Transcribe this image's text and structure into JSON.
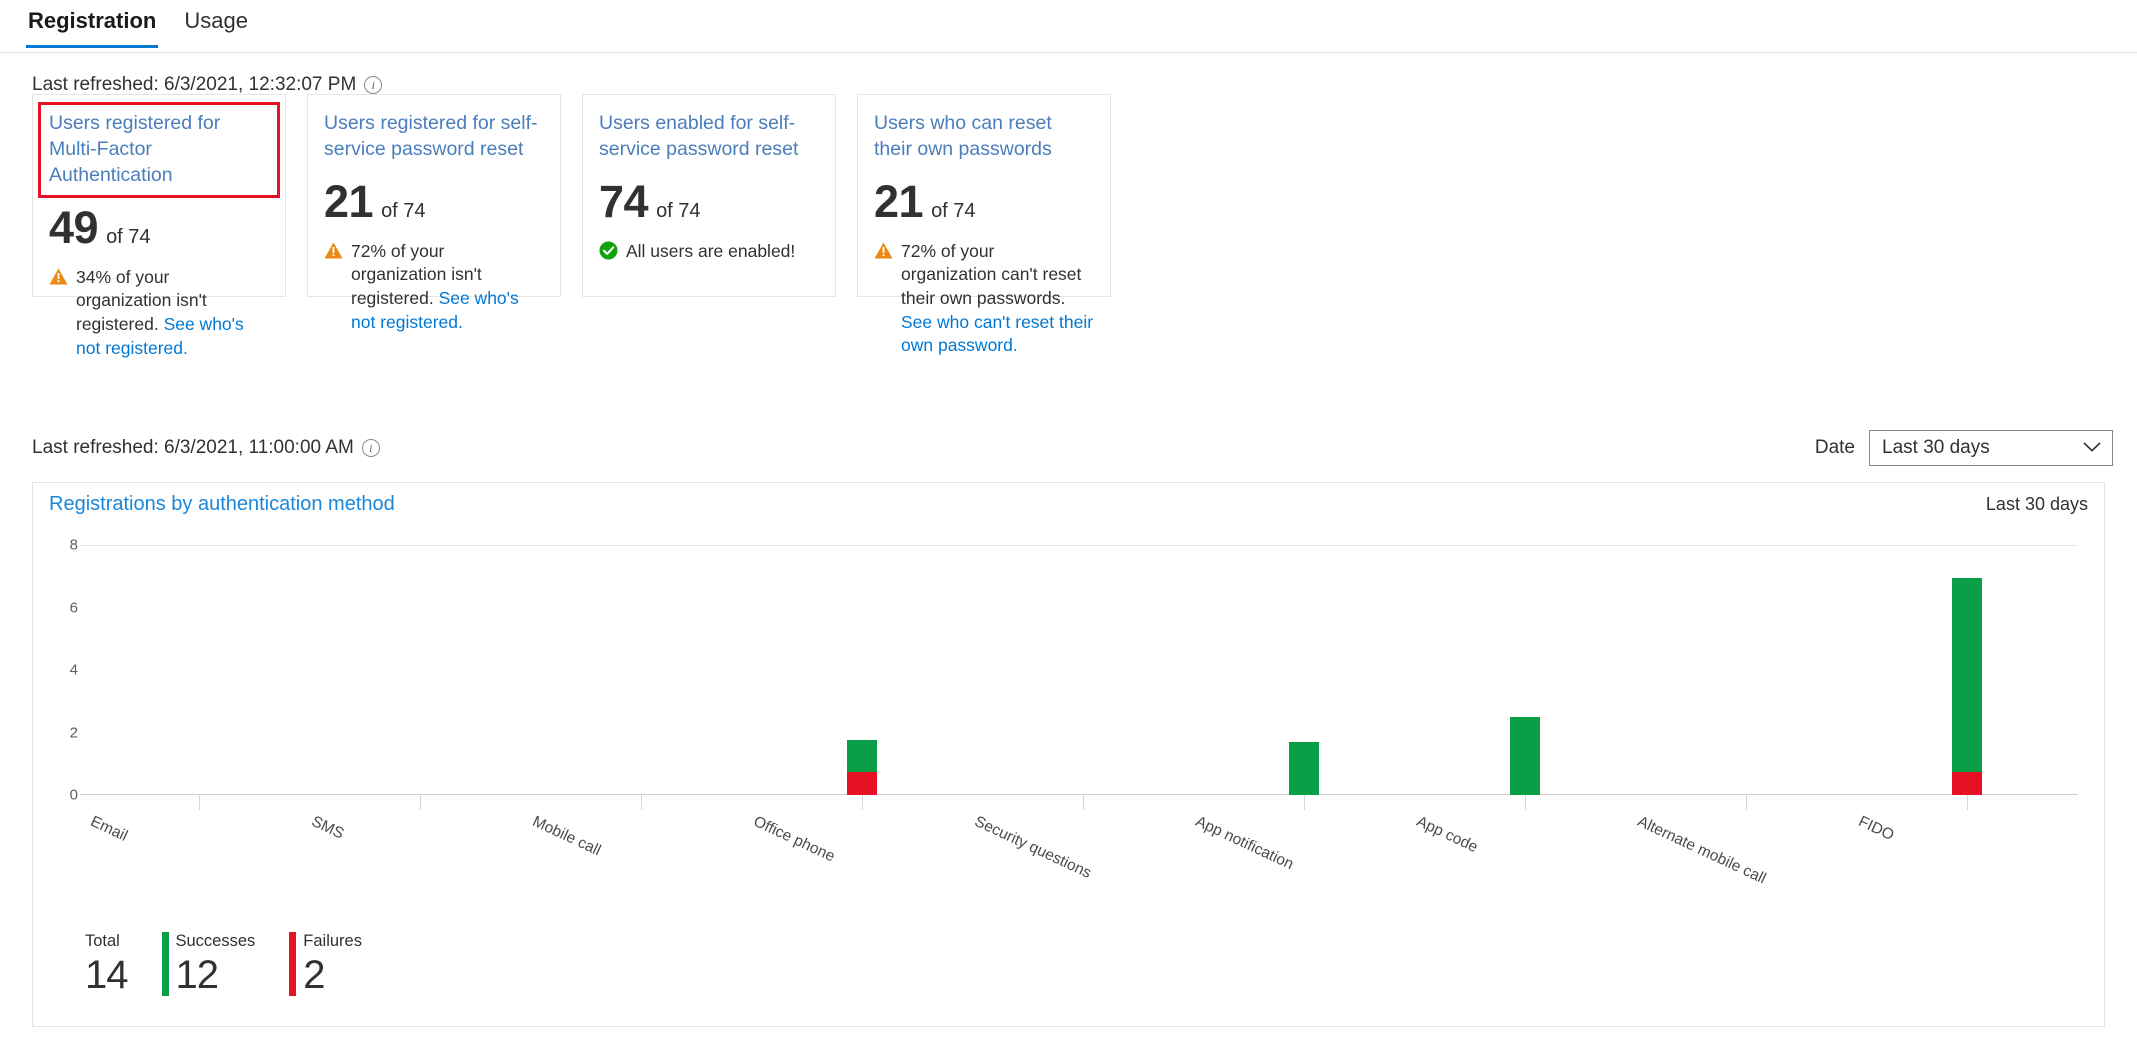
{
  "tabs": [
    {
      "label": "Registration",
      "active": true
    },
    {
      "label": "Usage",
      "active": false
    }
  ],
  "refresh_top": {
    "text": "Last refreshed: 6/3/2021, 12:32:07 PM",
    "info_icon": "info-icon"
  },
  "refresh_chart": {
    "text": "Last refreshed: 6/3/2021, 11:00:00 AM",
    "info_icon": "info-icon"
  },
  "cards": [
    {
      "title": "Users registered for Multi-Factor Authentication",
      "value": "49",
      "of": "of 74",
      "status": "warning",
      "status_icon": "warning-triangle-icon",
      "note": "34% of your organization isn't registered.",
      "link": "See who's not registered.",
      "highlighted": true
    },
    {
      "title": "Users registered for self-service password reset",
      "value": "21",
      "of": "of 74",
      "status": "warning",
      "status_icon": "warning-triangle-icon",
      "note": "72% of your organization isn't registered.",
      "link": "See who's not registered.",
      "highlighted": false
    },
    {
      "title": "Users enabled for self-service password reset",
      "value": "74",
      "of": "of 74",
      "status": "success",
      "status_icon": "check-circle-icon",
      "note": "All users are enabled!",
      "link": "",
      "highlighted": false
    },
    {
      "title": "Users who can reset their own passwords",
      "value": "21",
      "of": "of 74",
      "status": "warning",
      "status_icon": "warning-triangle-icon",
      "note": "72% of your organization can't reset their own passwords.",
      "link": "See who can't reset their own password.",
      "highlighted": false
    }
  ],
  "date_filter": {
    "label": "Date",
    "selected": "Last 30 days",
    "caret_icon": "chevron-down-icon",
    "options": [
      "Last 30 days"
    ]
  },
  "chart_panel": {
    "title": "Registrations by authentication method",
    "range_label": "Last 30 days"
  },
  "totals": [
    {
      "label": "Total",
      "value": "14",
      "color": ""
    },
    {
      "label": "Successes",
      "value": "12",
      "color": "#0b9e49"
    },
    {
      "label": "Failures",
      "value": "2",
      "color": "#e81123"
    }
  ],
  "colors": {
    "success": "#0b9e49",
    "failure": "#e81123",
    "accent": "#0078d4",
    "link": "#4a7ebb",
    "warning": "#e88a14",
    "highlight_outline": "#e81123"
  },
  "chart_data": {
    "type": "bar",
    "stacked": true,
    "title": "Registrations by authentication method",
    "xlabel": "",
    "ylabel": "",
    "ylim": [
      0,
      8
    ],
    "yticks": [
      0,
      2,
      4,
      6,
      8
    ],
    "grid": false,
    "legend_position": "bottom",
    "categories": [
      "Email",
      "SMS",
      "Mobile call",
      "Office phone",
      "Security questions",
      "App notification",
      "App code",
      "Alternate mobile call",
      "FIDO"
    ],
    "series": [
      {
        "name": "Successes",
        "color": "#0b9e49",
        "values": [
          0,
          0,
          0,
          1,
          0,
          1.7,
          2.5,
          0,
          6.2
        ]
      },
      {
        "name": "Failures",
        "color": "#e81123",
        "values": [
          0,
          0,
          0,
          0.75,
          0,
          0,
          0,
          0,
          0.75
        ]
      }
    ],
    "totals": {
      "Total": 14,
      "Successes": 12,
      "Failures": 2
    }
  }
}
